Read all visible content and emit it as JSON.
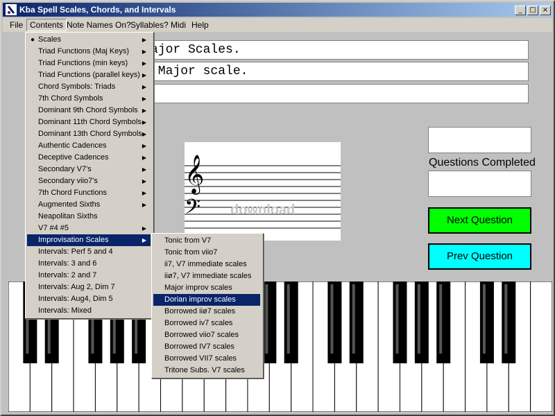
{
  "window": {
    "title": "Kba Spell Scales, Chords, and Intervals",
    "min": "_",
    "max": "□",
    "close": "×"
  },
  "menubar": [
    "File",
    "Contents",
    "Note Names On?",
    "Syllables?",
    "Midi",
    "Help"
  ],
  "question_lines": [
    "ajor Scales.",
    " Major scale.",
    ""
  ],
  "score_label": "Questions Completed",
  "buttons": {
    "next": "Next Question",
    "prev": "Prev Question"
  },
  "watermark": "download",
  "contents_menu": [
    {
      "label": "Scales",
      "checked": true,
      "submenu": true
    },
    {
      "label": "Triad Functions (Maj Keys)",
      "submenu": true
    },
    {
      "label": "Triad Functions (min keys)",
      "submenu": true
    },
    {
      "label": "Triad Functions (parallel keys)",
      "submenu": true
    },
    {
      "label": "Chord Symbols: Triads",
      "submenu": true
    },
    {
      "label": "7th Chord Symbols",
      "submenu": true
    },
    {
      "label": "Dominant 9th Chord Symbols",
      "submenu": true
    },
    {
      "label": "Dominant 11th Chord Symbols",
      "submenu": true
    },
    {
      "label": "Dominant 13th Chord Symbols",
      "submenu": true
    },
    {
      "label": "Authentic Cadences",
      "submenu": true
    },
    {
      "label": "Deceptive Cadences",
      "submenu": true
    },
    {
      "label": "Secondary V7's",
      "submenu": true
    },
    {
      "label": "Secondary viio7's",
      "submenu": true
    },
    {
      "label": "7th Chord Functions",
      "submenu": true
    },
    {
      "label": "Augmented Sixths",
      "submenu": true
    },
    {
      "label": "Neapolitan Sixths",
      "submenu": false
    },
    {
      "label": "V7 #4 #5",
      "submenu": true
    },
    {
      "label": "Improvisation Scales",
      "submenu": true,
      "highlighted": true
    },
    {
      "label": "Intervals: Perf 5 and 4",
      "submenu": false
    },
    {
      "label": "Intervals: 3 and 6",
      "submenu": false
    },
    {
      "label": "Intervals: 2 and 7",
      "submenu": false
    },
    {
      "label": "Intervals: Aug 2, Dim 7",
      "submenu": false
    },
    {
      "label": "Intervals: Aug4, Dim 5",
      "submenu": false
    },
    {
      "label": "Intervals: Mixed",
      "submenu": false
    }
  ],
  "improv_submenu": [
    {
      "label": "Tonic from V7"
    },
    {
      "label": "Tonic from viio7"
    },
    {
      "label": "ii7, V7 immediate scales"
    },
    {
      "label": "iiø7, V7 immediate scales"
    },
    {
      "label": "Major improv scales"
    },
    {
      "label": "Dorian improv scales",
      "highlighted": true
    },
    {
      "label": "Borrowed iiø7 scales"
    },
    {
      "label": "Borrowed iv7 scales"
    },
    {
      "label": "Borrowed viio7 scales"
    },
    {
      "label": "Borrowed IV7 scales"
    },
    {
      "label": "Borrowed VII7 scales"
    },
    {
      "label": "Tritone Subs. V7 scales"
    }
  ],
  "colors": {
    "titlebar": "#0a246a",
    "next": "#00ff00",
    "prev": "#00ffff",
    "highlight": "#0a246a"
  },
  "icons": {
    "app": "music-note-icon",
    "treble": "treble-clef-icon",
    "bass": "bass-clef-icon"
  },
  "clefs": {
    "treble": "𝄞",
    "bass": "𝄢"
  }
}
